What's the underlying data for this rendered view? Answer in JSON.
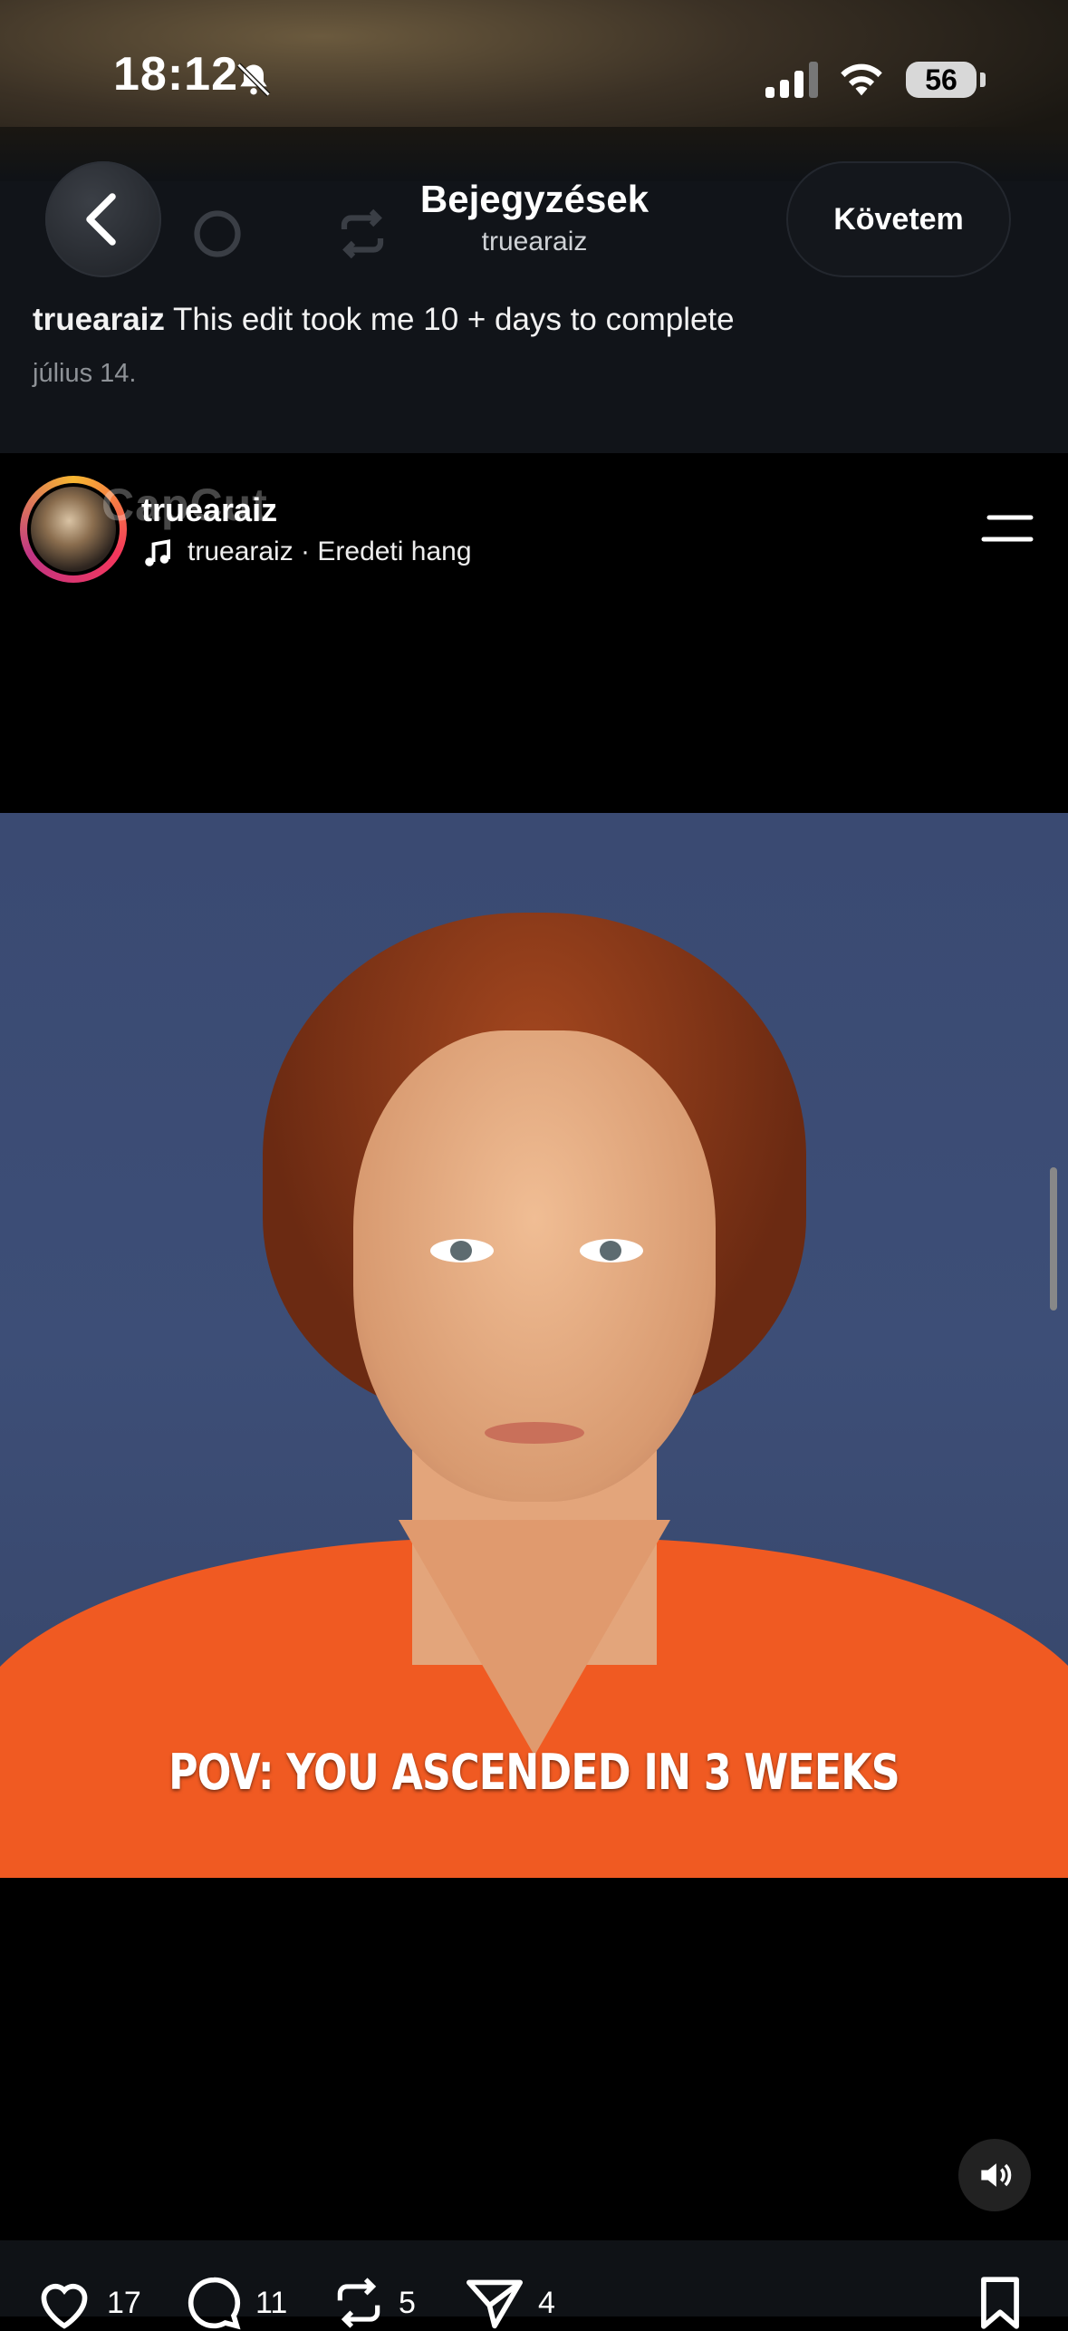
{
  "status_bar": {
    "time": "18:12",
    "battery": "56"
  },
  "header": {
    "title": "Bejegyzések",
    "subtitle": "truearaiz",
    "follow_label": "Követem"
  },
  "caption": {
    "username": "truearaiz",
    "text": "This edit took me 10 + days to complete",
    "date": "július 14."
  },
  "post": {
    "username": "truearaiz",
    "watermark": "CapCut",
    "audio": "truearaiz · Eredeti hang",
    "overlay_text": "POV: YOU ASCENDED IN 3 WEEKS"
  },
  "actions": {
    "likes": "17",
    "comments": "11",
    "reposts": "5",
    "shares": "4"
  },
  "colors": {
    "background": "#000000",
    "header_bg": "#111419",
    "photo_bg": "#3a4a72",
    "shirt": "#f05a22"
  }
}
